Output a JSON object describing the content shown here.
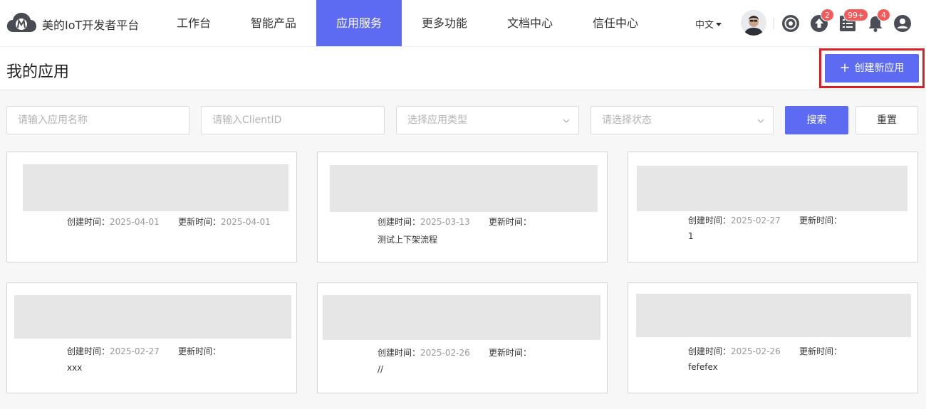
{
  "header": {
    "brand": "美的IoT开发者平台",
    "nav": [
      {
        "label": "工作台"
      },
      {
        "label": "智能产品"
      },
      {
        "label": "应用服务"
      },
      {
        "label": "更多功能"
      },
      {
        "label": "文档中心"
      },
      {
        "label": "信任中心"
      }
    ],
    "language": "中文",
    "badges": {
      "upload": "2",
      "tasks": "99+",
      "notifications": "4"
    },
    "accent_color": "#5d6bf3"
  },
  "page": {
    "title": "我的应用",
    "create_button": "创建新应用",
    "highlight_color": "#d92027"
  },
  "filters": {
    "name_placeholder": "请输入应用名称",
    "clientid_placeholder": "请输入ClientID",
    "type_placeholder": "选择应用类型",
    "status_placeholder": "请选择状态",
    "search_button": "搜索",
    "reset_button": "重置"
  },
  "cards": [
    {
      "created_label": "创建时间：",
      "created": "2025-04-01",
      "updated_label": "更新时间：",
      "updated": "2025-04-01",
      "desc": ""
    },
    {
      "created_label": "创建时间：",
      "created": "2025-03-13",
      "updated_label": "更新时间：",
      "updated": "",
      "desc": "测试上下架流程"
    },
    {
      "created_label": "创建时间：",
      "created": "2025-02-27",
      "updated_label": "更新时间：",
      "updated": "",
      "desc": "1"
    },
    {
      "created_label": "创建时间：",
      "created": "2025-02-27",
      "updated_label": "更新时间：",
      "updated": "",
      "desc": "xxx"
    },
    {
      "created_label": "创建时间：",
      "created": "2025-02-26",
      "updated_label": "更新时间：",
      "updated": "",
      "desc": "//"
    },
    {
      "created_label": "创建时间：",
      "created": "2025-02-26",
      "updated_label": "更新时间：",
      "updated": "",
      "desc": "fefefex"
    }
  ]
}
